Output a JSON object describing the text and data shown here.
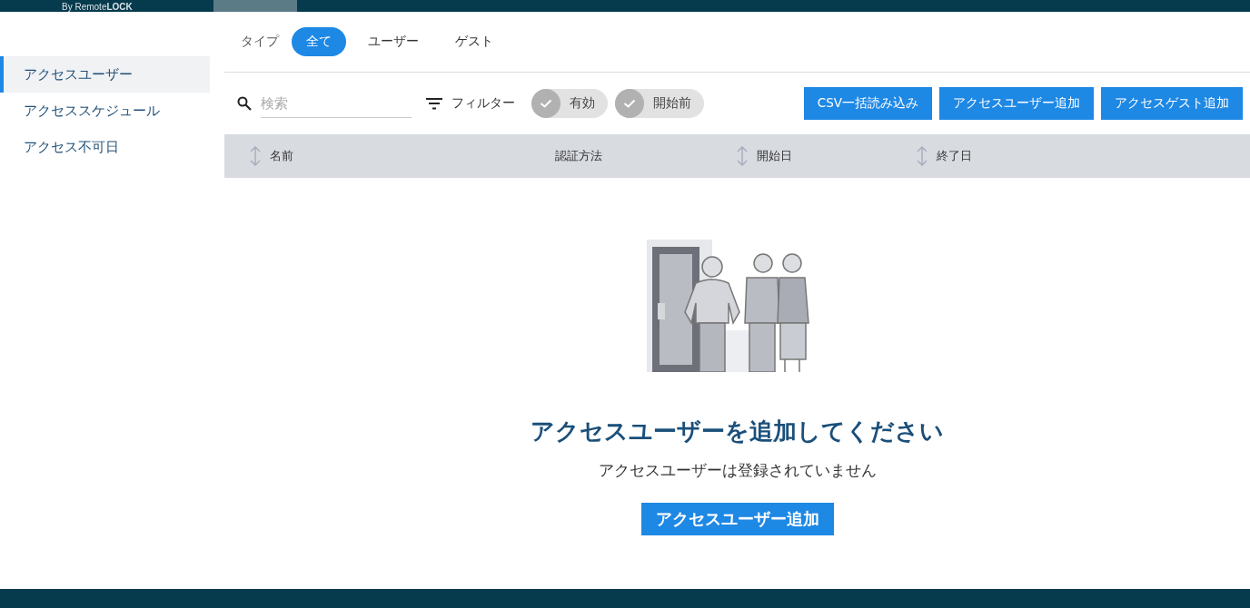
{
  "header": {
    "logo": "By Remote**LOCK**"
  },
  "sidebar": {
    "items": [
      {
        "label": "アクセスユーザー",
        "selected": true
      },
      {
        "label": "アクセススケジュール",
        "selected": false
      },
      {
        "label": "アクセス不可日",
        "selected": false
      }
    ]
  },
  "type_filter": {
    "label": "タイプ",
    "options": [
      {
        "label": "全て",
        "selected": true
      },
      {
        "label": "ユーザー",
        "selected": false
      },
      {
        "label": "ゲスト",
        "selected": false
      }
    ]
  },
  "toolbar": {
    "search": {
      "placeholder": "検索"
    },
    "filter_label": "フィルター",
    "chips": [
      {
        "label": "有効",
        "checked": true
      },
      {
        "label": "開始前",
        "checked": true
      }
    ],
    "buttons": [
      "CSV一括読み込み",
      "アクセスユーザー追加",
      "アクセスゲスト追加"
    ]
  },
  "table": {
    "columns": [
      {
        "label": "名前",
        "sortable": true
      },
      {
        "label": "認証方法",
        "sortable": false
      },
      {
        "label": "開始日",
        "sortable": true
      },
      {
        "label": "終了日",
        "sortable": true
      }
    ]
  },
  "empty_state": {
    "title": "アクセスユーザーを追加してください",
    "message": "アクセスユーザーは登録されていません",
    "button": "アクセスユーザー追加"
  }
}
